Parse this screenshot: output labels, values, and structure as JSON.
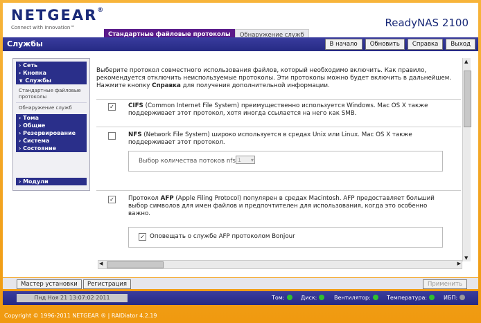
{
  "brand": {
    "logo": "NETGEAR",
    "logo_reg": "®",
    "tagline": "Connect with Innovation™",
    "product": "ReadyNAS 2100"
  },
  "tabs": [
    {
      "label": "Стандартные файловые протоколы"
    },
    {
      "label": "Обнаружение служб"
    }
  ],
  "page_title": "Службы",
  "topbar": {
    "home": "В начало",
    "refresh": "Обновить",
    "help": "Справка",
    "logout": "Выход"
  },
  "sidebar": {
    "items": [
      {
        "label": "Сеть"
      },
      {
        "label": "Кнопка"
      },
      {
        "label": "Службы"
      },
      {
        "label": "Тома"
      },
      {
        "label": "Общие"
      },
      {
        "label": "Резервирование"
      },
      {
        "label": "Система"
      },
      {
        "label": "Состояние"
      },
      {
        "label": "Модули"
      }
    ],
    "sub": [
      {
        "label": "Стандартные файловые протоколы"
      },
      {
        "label": "Обнаружение служб"
      }
    ],
    "arrow": "›",
    "expanded": "∨"
  },
  "intro": {
    "text1": "Выберите протокол совместного использования файлов, который необходимо включить. Как правило, рекомендуется отключить неиспользуемые протоколы. Эти протоколы можно будет включить в дальнейшем. Нажмите кнопку ",
    "bold": "Справка",
    "text2": " для получения дополнительной информации."
  },
  "cifs": {
    "checked": "✓",
    "name": "CIFS",
    "desc": " (Common Internet File System) преимущественно используется Windows. Mac OS X также поддерживает этот протокол, хотя иногда ссылается на него как SMB."
  },
  "nfs": {
    "name": "NFS",
    "desc": " (Network File System) широко используется в средах Unix или Linux. Mac OS X также поддерживает этот протокол.",
    "threads_label": "Выбор количества потоков nfs:",
    "threads_value": "1"
  },
  "afp": {
    "checked": "✓",
    "prefix": "Протокол ",
    "name": "AFP",
    "desc": " (Apple Filing Protocol) популярен в средах Macintosh. AFP предоставляет больший выбор символов для имен файлов и предпочтителен для использования, когда это особенно важно.",
    "bonjour_checked": "✓",
    "bonjour_label": "Оповещать о службе AFP протоколом Bonjour"
  },
  "bottom": {
    "wizard": "Мастер установки",
    "register": "Регистрация",
    "apply": "Применить"
  },
  "status": {
    "datetime": "Пнд Ноя 21  13:07:02 2011",
    "volume": "Том:",
    "disk": "Диск:",
    "fan": "Вентилятор:",
    "temp": "Температура:",
    "ups": "ИБП:",
    "green": "#2fbf2f",
    "grey": "#9a9a9a"
  },
  "footer": "Copyright © 1996-2011 NETGEAR ® | RAIDiator 4.2.19"
}
